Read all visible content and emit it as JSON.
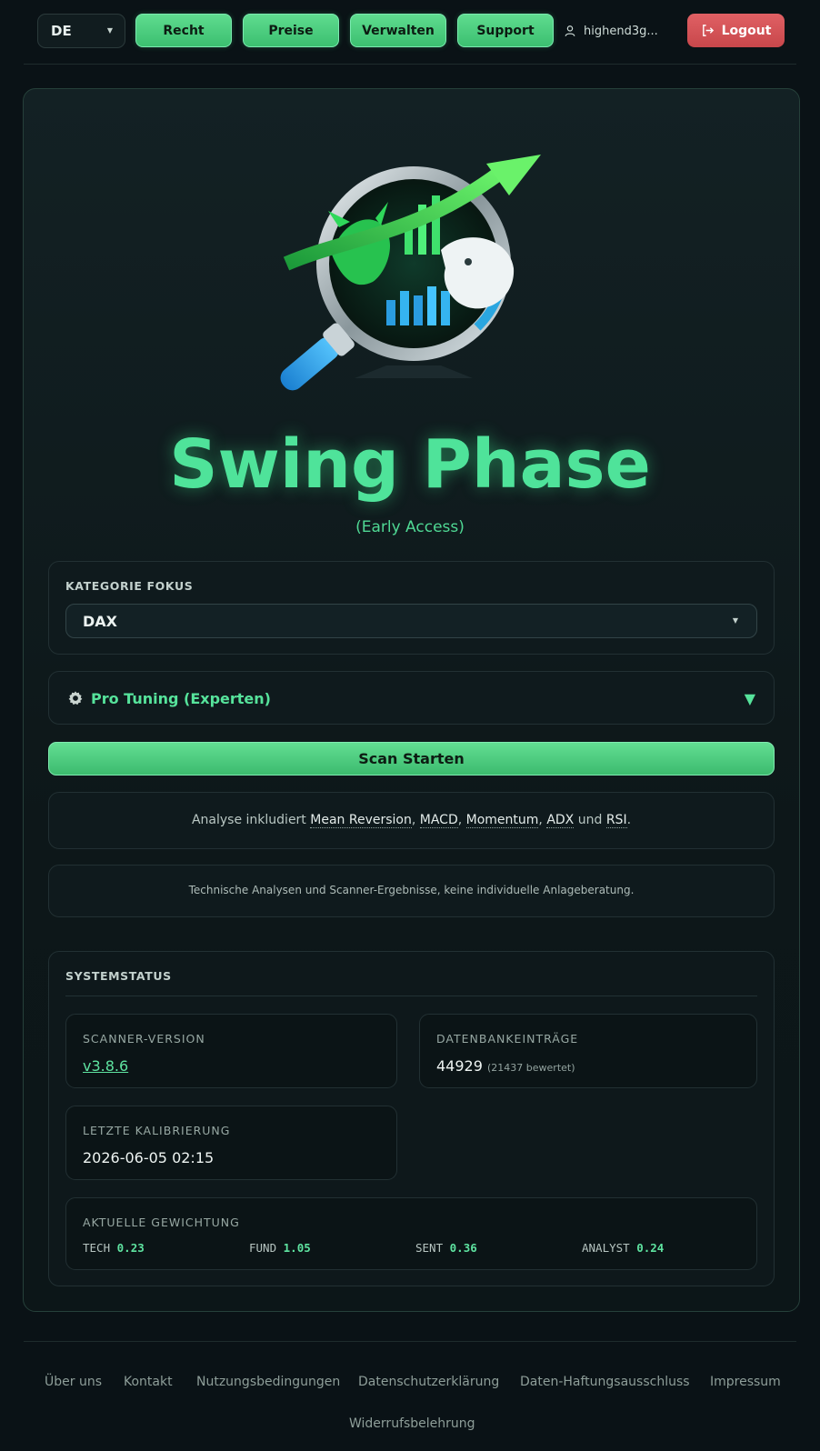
{
  "nav": {
    "language": "DE",
    "buttons": [
      "Recht",
      "Preise",
      "Verwalten",
      "Support"
    ],
    "user": "highend3g...",
    "logout": "Logout",
    "colors": {
      "accent": "#4fe39a",
      "logout": "#c8474b"
    }
  },
  "hero": {
    "title": "Swing Phase",
    "subtitle": "(Early Access)"
  },
  "category": {
    "label": "KATEGORIE FOKUS",
    "selected": "DAX"
  },
  "tuning": {
    "label": "Pro Tuning (Experten)",
    "caret": "▼"
  },
  "scan_button": "Scan Starten",
  "analysis": {
    "prefix": "Analyse inkludiert",
    "terms": [
      "Mean Reversion",
      "MACD",
      "Momentum",
      "ADX",
      "RSI"
    ],
    "conjunction": "und"
  },
  "disclaimer": "Technische Analysen und Scanner-Ergebnisse, keine individuelle Anlageberatung.",
  "system_status": {
    "title": "SYSTEMSTATUS",
    "scanner_version_label": "SCANNER-VERSION",
    "scanner_version": "v3.8.6",
    "db_entries_label": "DATENBANKEINTRÄGE",
    "db_entries": "44929",
    "db_entries_note": "(21437 bewertet)",
    "calibration_label": "LETZTE KALIBRIERUNG",
    "calibration": "2026-06-05 02:15",
    "weights_label": "AKTUELLE GEWICHTUNG",
    "weights": [
      {
        "name": "TECH",
        "value": "0.23"
      },
      {
        "name": "FUND",
        "value": "1.05"
      },
      {
        "name": "SENT",
        "value": "0.36"
      },
      {
        "name": "ANALYST",
        "value": "0.24"
      }
    ]
  },
  "footer": {
    "links": [
      "Über uns",
      "Kontakt",
      "Nutzungsbedingungen",
      "Datenschutzerklärung",
      "Daten-Haftungsausschluss",
      "Impressum",
      "Widerrufsbelehrung"
    ]
  }
}
